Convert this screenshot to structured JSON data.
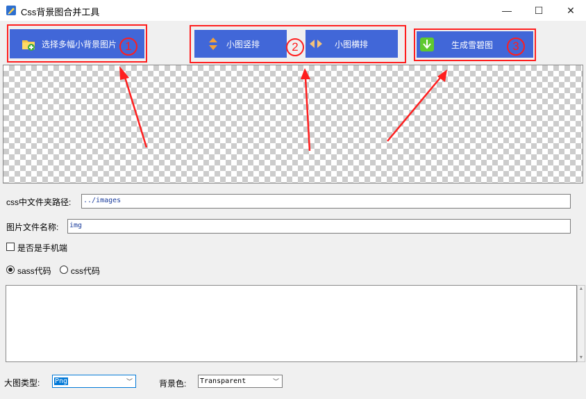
{
  "window": {
    "title": "Css背景图合并工具",
    "minimize": "—",
    "maximize": "☐",
    "close": "✕"
  },
  "toolbar": {
    "select_button": "选择多幅小背景图片",
    "vertical_button": "小图竖排",
    "horizontal_button": "小图横排",
    "generate_button": "生成雪碧图"
  },
  "annotations": {
    "step1": "1",
    "step2": "2",
    "step3": "3",
    "color": "#ff1e1e"
  },
  "form": {
    "css_path_label": "css中文件夹路径:",
    "css_path_value": "../images",
    "image_name_label": "图片文件名称:",
    "image_name_value": "img",
    "mobile_label": "是否是手机端",
    "mobile_checked": false,
    "code_type_options": [
      "sass代码",
      "css代码"
    ],
    "code_type_selected": "sass代码",
    "code_output": "",
    "image_type_label": "大图类型:",
    "image_type_value": "Png",
    "bg_color_label": "背景色:",
    "bg_color_value": "Transparent"
  },
  "colors": {
    "button_blue": "#4167d8",
    "highlight_red": "#ff1e1e",
    "selection_blue": "#0078d7"
  },
  "icons": [
    "folder-add-icon",
    "vertical-arrows-icon",
    "horizontal-arrows-icon",
    "download-icon"
  ]
}
